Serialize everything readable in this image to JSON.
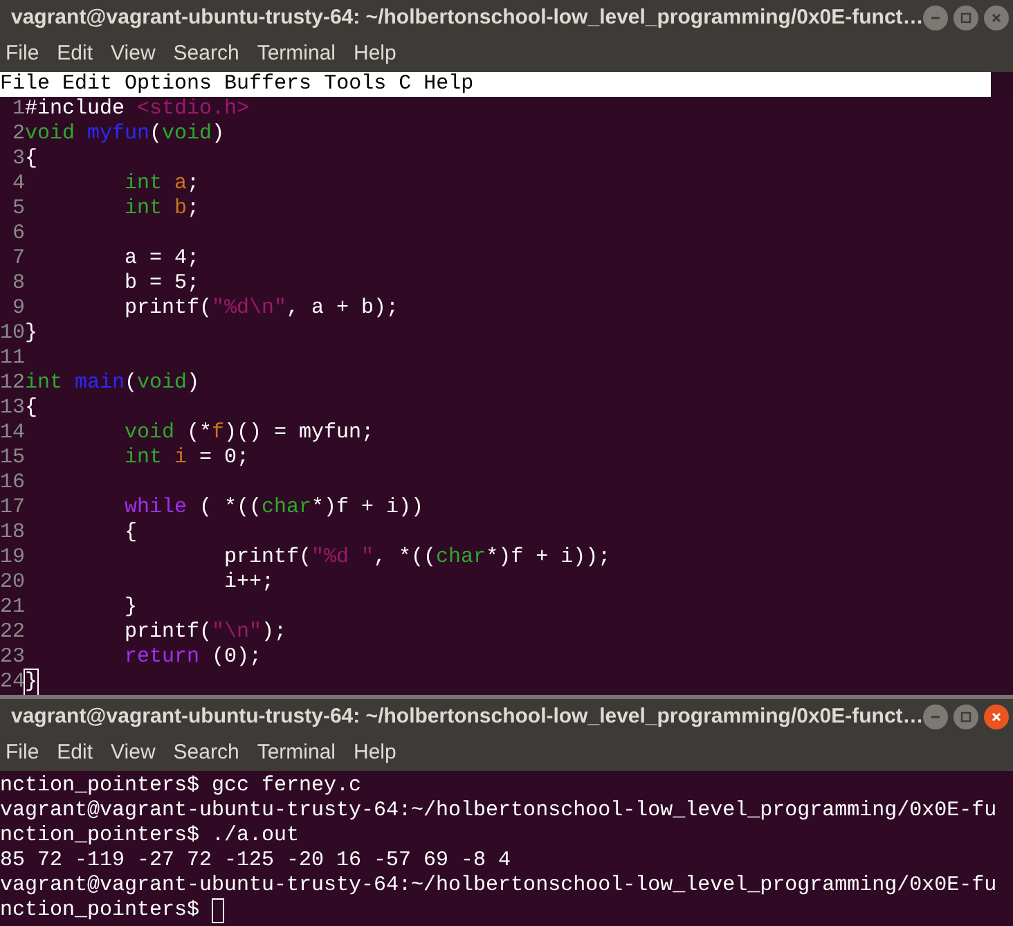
{
  "windows": [
    {
      "title": "vagrant@vagrant-ubuntu-trusty-64: ~/holbertonschool-low_level_programming/0x0E-funct…",
      "active": false,
      "menu": [
        "File",
        "Edit",
        "View",
        "Search",
        "Terminal",
        "Help"
      ],
      "editor": {
        "menu": [
          "File",
          "Edit",
          "Options",
          "Buffers",
          "Tools",
          "C",
          "Help"
        ],
        "lines": [
          {
            "number": "1",
            "kind": "flush",
            "segments": [
              {
                "text": "#include",
                "kind": "plain"
              },
              {
                "text": " <stdio.h>",
                "kind": "string"
              }
            ]
          },
          {
            "number": "2",
            "kind": "flush",
            "segments": [
              {
                "text": "void",
                "kind": "type"
              },
              {
                "text": " myfun",
                "kind": "function"
              },
              {
                "text": "(",
                "kind": "plain"
              },
              {
                "text": "void",
                "kind": "type"
              },
              {
                "text": ")",
                "kind": "plain"
              }
            ]
          },
          {
            "number": "3",
            "kind": "flush",
            "segments": [
              {
                "text": "{",
                "kind": "plain"
              }
            ]
          },
          {
            "number": "4",
            "kind": "indented",
            "segments": [
              {
                "text": "int",
                "kind": "type"
              },
              {
                "text": " a",
                "kind": "variable"
              },
              {
                "text": ";",
                "kind": "plain"
              }
            ]
          },
          {
            "number": "5",
            "kind": "indented",
            "segments": [
              {
                "text": "int",
                "kind": "type"
              },
              {
                "text": " b",
                "kind": "variable"
              },
              {
                "text": ";",
                "kind": "plain"
              }
            ]
          },
          {
            "number": "6",
            "kind": "flush"
          },
          {
            "number": "7",
            "kind": "indented",
            "segments": [
              {
                "text": "a = 4;",
                "kind": "plain"
              }
            ]
          },
          {
            "number": "8",
            "kind": "indented",
            "segments": [
              {
                "text": "b = 5;",
                "kind": "plain"
              }
            ]
          },
          {
            "number": "9",
            "kind": "indented",
            "segments": [
              {
                "text": "printf(",
                "kind": "plain"
              },
              {
                "text": "\"%d\\n\"",
                "kind": "string"
              },
              {
                "text": ", a + b);",
                "kind": "plain"
              }
            ]
          },
          {
            "number": "10",
            "kind": "flush",
            "segments": [
              {
                "text": "}",
                "kind": "plain"
              }
            ]
          },
          {
            "number": "11",
            "kind": "flush"
          },
          {
            "number": "12",
            "kind": "flush",
            "segments": [
              {
                "text": "int",
                "kind": "type"
              },
              {
                "text": " main",
                "kind": "function"
              },
              {
                "text": "(",
                "kind": "plain"
              },
              {
                "text": "void",
                "kind": "type"
              },
              {
                "text": ")",
                "kind": "plain"
              }
            ]
          },
          {
            "number": "13",
            "kind": "flush",
            "segments": [
              {
                "text": "{",
                "kind": "plain"
              }
            ]
          },
          {
            "number": "14",
            "kind": "indented",
            "segments": [
              {
                "text": "void",
                "kind": "type"
              },
              {
                "text": " (*",
                "kind": "plain"
              },
              {
                "text": "f",
                "kind": "variable"
              },
              {
                "text": ")() = myfun;",
                "kind": "plain"
              }
            ]
          },
          {
            "number": "15",
            "kind": "indented",
            "segments": [
              {
                "text": "int",
                "kind": "type"
              },
              {
                "text": " i",
                "kind": "variable"
              },
              {
                "text": " = 0;",
                "kind": "plain"
              }
            ]
          },
          {
            "number": "16",
            "kind": "flush"
          },
          {
            "number": "17",
            "kind": "indented",
            "segments": [
              {
                "text": "while",
                "kind": "keyword"
              },
              {
                "text": " ( *((",
                "kind": "plain"
              },
              {
                "text": "char",
                "kind": "type"
              },
              {
                "text": "*)f + i))",
                "kind": "plain"
              }
            ]
          },
          {
            "number": "18",
            "kind": "indented",
            "segments": [
              {
                "text": "{",
                "kind": "plain"
              }
            ]
          },
          {
            "number": "19",
            "kind": "double_indented",
            "segments": [
              {
                "text": "printf(",
                "kind": "plain"
              },
              {
                "text": "\"%d \"",
                "kind": "string"
              },
              {
                "text": ", *((",
                "kind": "plain"
              },
              {
                "text": "char",
                "kind": "type"
              },
              {
                "text": "*)f + i));",
                "kind": "plain"
              }
            ]
          },
          {
            "number": "20",
            "kind": "double_indented",
            "segments": [
              {
                "text": "i++;",
                "kind": "plain"
              }
            ]
          },
          {
            "number": "21",
            "kind": "indented",
            "segments": [
              {
                "text": "}",
                "kind": "plain"
              }
            ]
          },
          {
            "number": "22",
            "kind": "indented",
            "segments": [
              {
                "text": "printf(",
                "kind": "plain"
              },
              {
                "text": "\"\\n\"",
                "kind": "string"
              },
              {
                "text": ");",
                "kind": "plain"
              }
            ]
          },
          {
            "number": "23",
            "kind": "indented",
            "segments": [
              {
                "text": "return",
                "kind": "keyword"
              },
              {
                "text": " (0);",
                "kind": "plain"
              }
            ]
          },
          {
            "number": "24",
            "kind": "flush",
            "segments": [
              {
                "text": "}",
                "kind": "cursor"
              }
            ]
          }
        ]
      }
    },
    {
      "title": "vagrant@vagrant-ubuntu-trusty-64: ~/holbertonschool-low_level_programming/0x0E-funct…",
      "active": true,
      "menu": [
        "File",
        "Edit",
        "View",
        "Search",
        "Terminal",
        "Help"
      ],
      "terminal": {
        "lines": [
          "nction_pointers$ gcc ferney.c",
          "vagrant@vagrant-ubuntu-trusty-64:~/holbertonschool-low_level_programming/0x0E-fu",
          "nction_pointers$ ./a.out",
          "85 72 -119 -27 72 -125 -20 16 -57 69 -8 4",
          "vagrant@vagrant-ubuntu-trusty-64:~/holbertonschool-low_level_programming/0x0E-fu",
          "nction_pointers$"
        ],
        "cursor": true
      }
    }
  ]
}
